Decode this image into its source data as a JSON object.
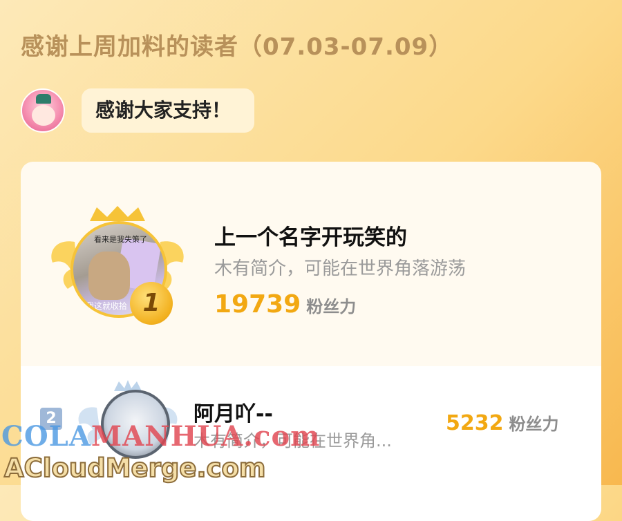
{
  "header": {
    "title": "感谢上周加料的读者（07.03-07.09）"
  },
  "message": {
    "text": "感谢大家支持！"
  },
  "ranking": [
    {
      "rank": "1",
      "name": "上一个名字开玩笑的",
      "bio": "木有简介，可能在世界角落游荡",
      "fans": "19739",
      "fans_label": "粉丝力",
      "avatar_text_top": "看来是我失策了",
      "avatar_text_bottom": "我这就收拾"
    },
    {
      "rank": "2",
      "name": "阿月吖--",
      "bio": "木有简介，可能在世界角...",
      "fans": "5232",
      "fans_label": "粉丝力"
    }
  ],
  "watermarks": {
    "colamanhua_part1": "COLA",
    "colamanhua_part2": "MANHUA.com",
    "acloudmerge": "ACloudMerge.com"
  },
  "colors": {
    "accent_gold": "#f2a812",
    "title_brown": "#b8915a",
    "bg_orange": "#f8b84f"
  }
}
